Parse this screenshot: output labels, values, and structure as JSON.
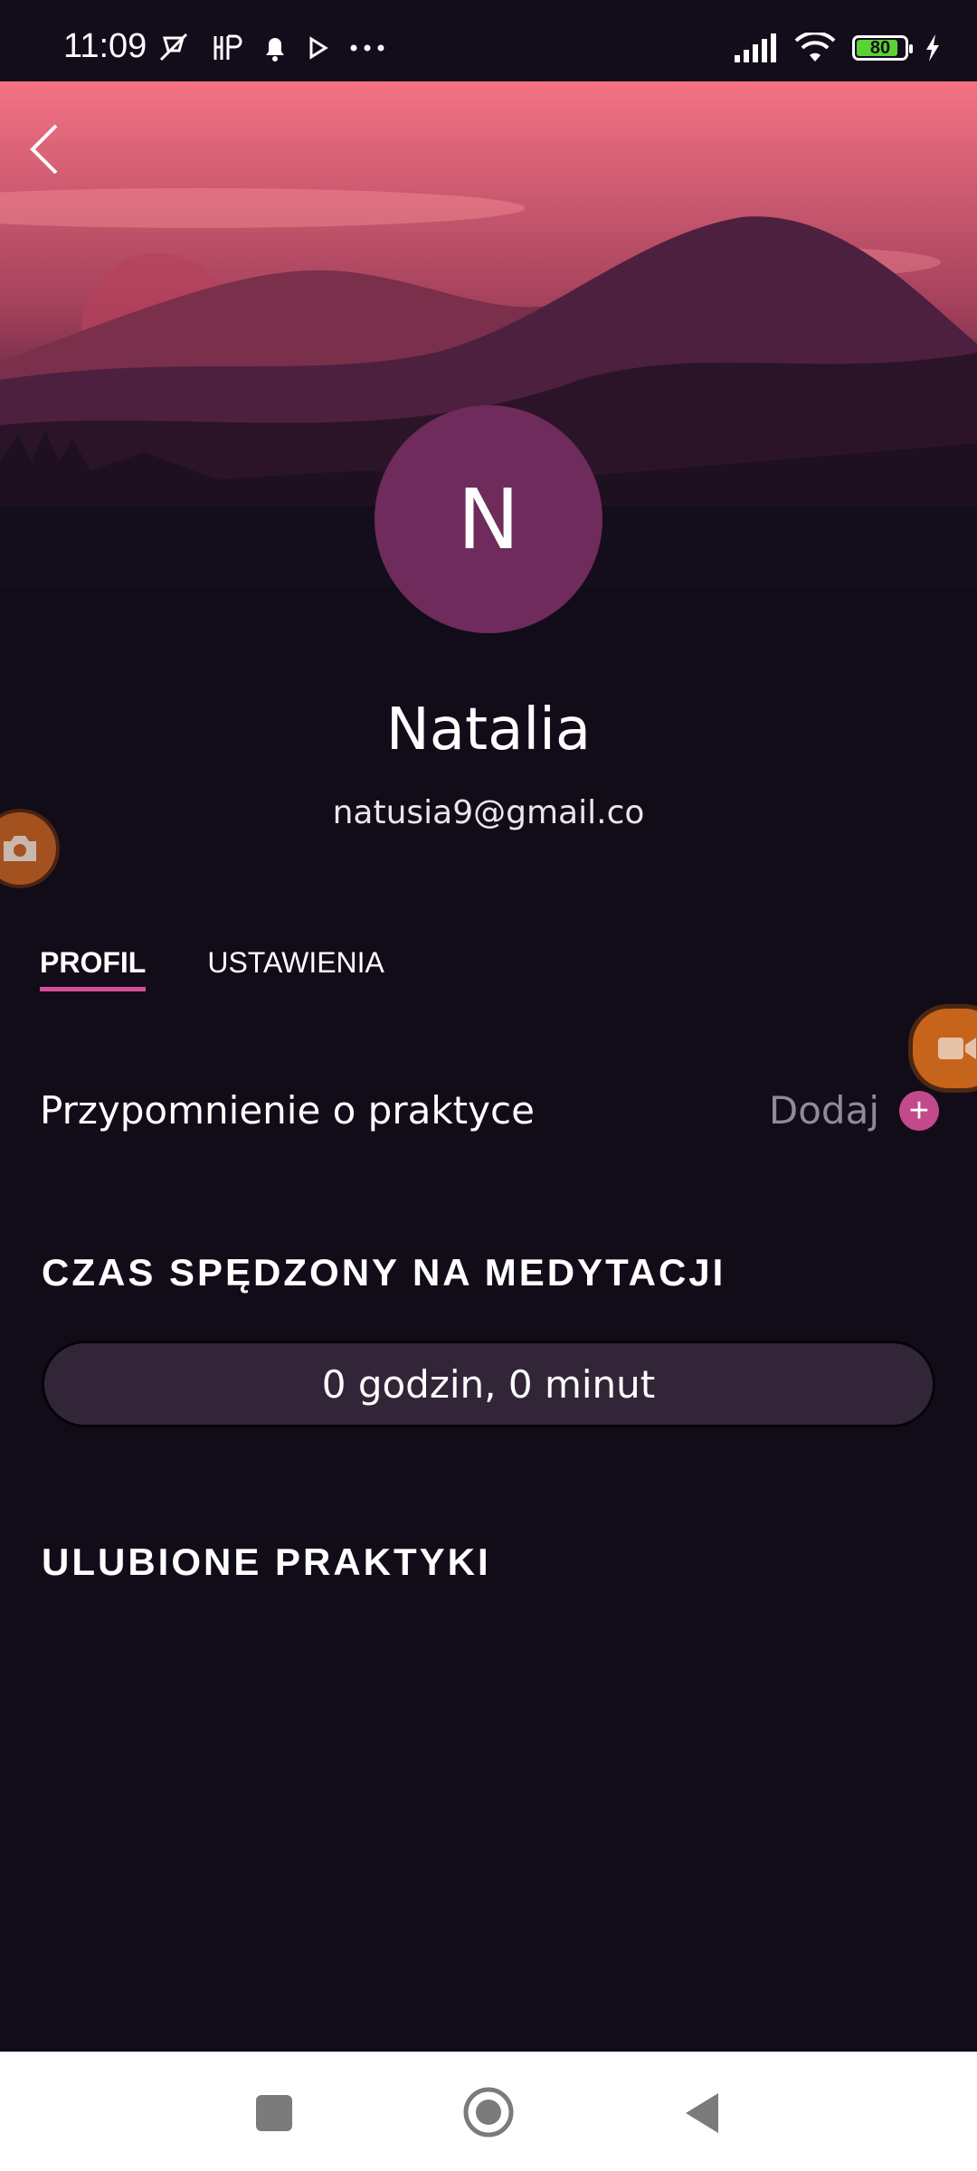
{
  "status_bar": {
    "time": "11:09",
    "battery_level": "80",
    "icons": [
      "mute-icon",
      "app-icon",
      "bell-icon",
      "play-icon",
      "more-icon",
      "signal-icon",
      "wifi-icon",
      "battery-icon",
      "charging-icon"
    ]
  },
  "header": {
    "back_icon": "back-icon"
  },
  "profile": {
    "initial": "N",
    "name": "Natalia",
    "email": "natusia9@gmail.co"
  },
  "tabs": [
    {
      "label": "PROFIL",
      "active": true
    },
    {
      "label": "USTAWIENIA",
      "active": false
    }
  ],
  "reminder": {
    "label": "Przypomnienie o praktyce",
    "action_label": "Dodaj"
  },
  "meditation_time": {
    "title": "CZAS SPĘDZONY NA MEDYTACJI",
    "value": "0 godzin, 0 minut"
  },
  "favorites": {
    "title": "ULUBIONE PRAKTYKI"
  },
  "colors": {
    "background": "#120c19",
    "accent": "#d64f98",
    "avatar": "#6e2b5c",
    "pill": "#322538"
  }
}
